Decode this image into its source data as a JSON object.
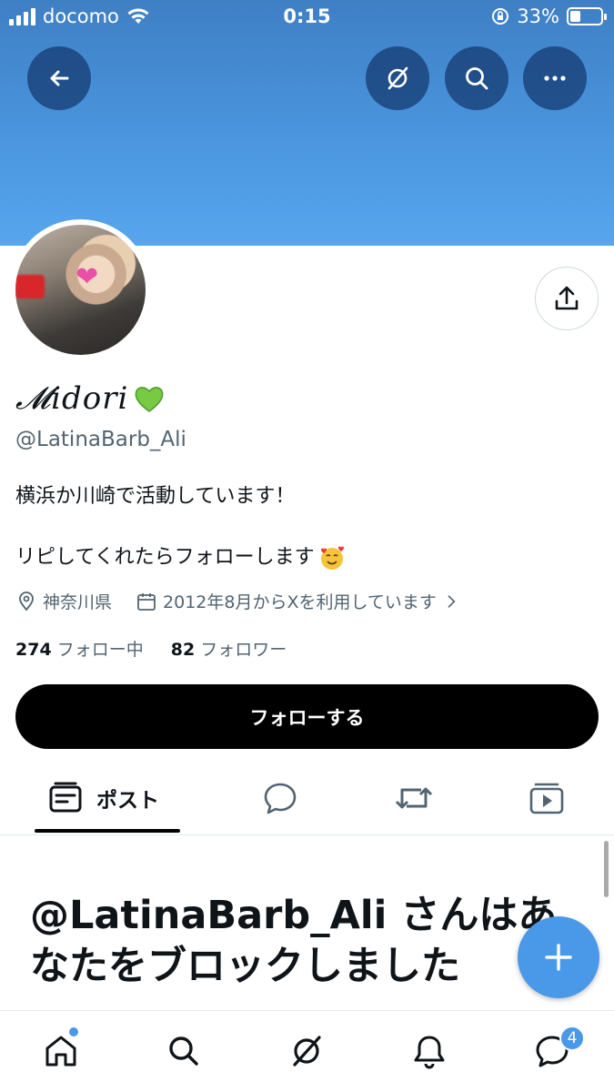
{
  "status_bar": {
    "carrier": "docomo",
    "time": "0:15",
    "battery": "33%",
    "battery_level": 0.33
  },
  "header": {
    "back_icon": "arrow-left-icon",
    "grok_icon": "grok-icon",
    "search_icon": "search-icon",
    "more_icon": "more-horizontal-icon"
  },
  "profile": {
    "display_name": "𝓜idori",
    "handle": "@LatinaBarb_Ali",
    "bio_line1": "横浜か川崎で活動しています！",
    "bio_line2": "リピしてくれたらフォローします",
    "location": "神奈川県",
    "joined": "2012年8月からXを利用しています",
    "following_count": "274",
    "following_label": "フォロー中",
    "followers_count": "82",
    "followers_label": "フォロワー",
    "follow_button": "フォローする"
  },
  "tabs": [
    {
      "label": "ポスト",
      "icon": "posts-icon",
      "active": true
    },
    {
      "label": "",
      "icon": "reply-icon",
      "active": false
    },
    {
      "label": "",
      "icon": "repost-icon",
      "active": false
    },
    {
      "label": "",
      "icon": "media-icon",
      "active": false
    }
  ],
  "blocked_message": "@LatinaBarb_Ali さんはあなたをブロックしました",
  "bottom_nav": {
    "items": [
      "home-icon",
      "search-icon",
      "grok-icon",
      "notifications-icon",
      "messages-icon"
    ],
    "messages_badge": "4"
  },
  "colors": {
    "banner": "#4a95de",
    "accent": "#4a99e9",
    "follow_button": "#000000"
  }
}
